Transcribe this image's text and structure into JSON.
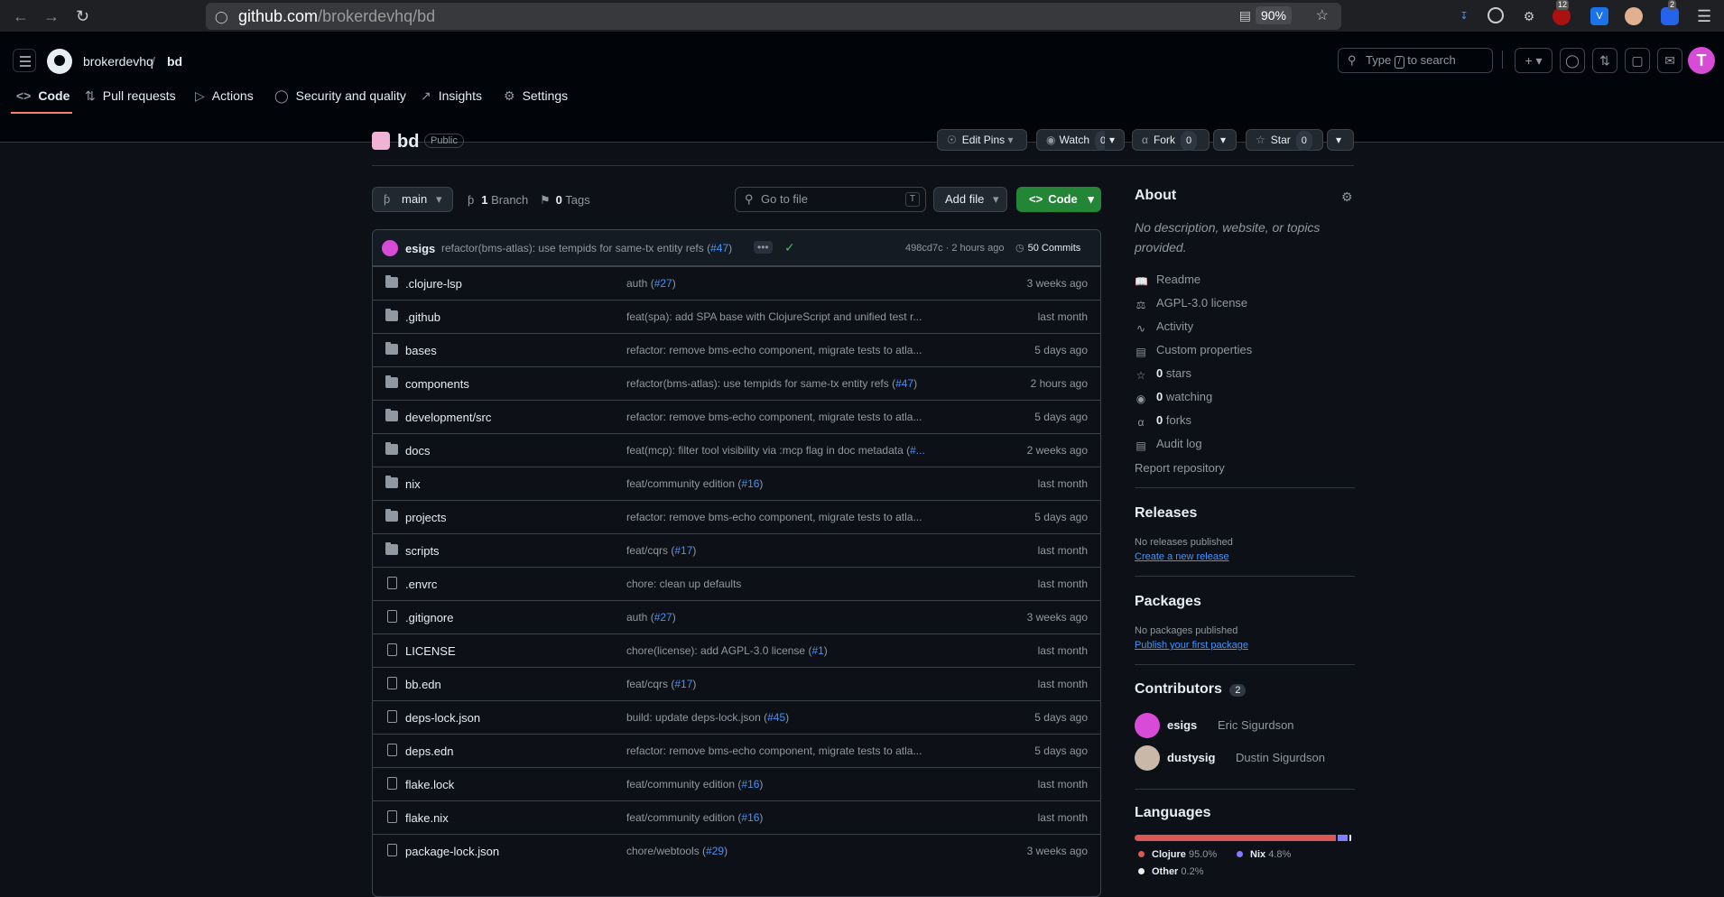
{
  "browser": {
    "url_host": "github.com",
    "url_path": "/brokerdevhq/bd",
    "zoom": "90%",
    "ext_badge_1": "12",
    "ext_badge_2": "2"
  },
  "header": {
    "org": "brokerdevhq",
    "sep": "/",
    "repo": "bd",
    "search_placeholder_pre": "Type",
    "search_key": "/",
    "search_placeholder_post": "to search",
    "avatar_letter": "T"
  },
  "tabs": [
    {
      "label": "Code",
      "icon": "code-icon"
    },
    {
      "label": "Pull requests",
      "icon": "pull-request-icon"
    },
    {
      "label": "Actions",
      "icon": "play-icon"
    },
    {
      "label": "Security and quality",
      "icon": "shield-icon"
    },
    {
      "label": "Insights",
      "icon": "graph-icon"
    },
    {
      "label": "Settings",
      "icon": "gear-icon"
    }
  ],
  "repo": {
    "name": "bd",
    "visibility": "Public",
    "edit_pins": "Edit Pins",
    "watch": "Watch",
    "watch_count": "0",
    "fork": "Fork",
    "fork_count": "0",
    "star": "Star",
    "star_count": "0"
  },
  "toolbar": {
    "branch": "main",
    "branches_count": "1",
    "branches_label": "Branch",
    "tags_count": "0",
    "tags_label": "Tags",
    "goto_placeholder": "Go to file",
    "goto_key": "T",
    "add_file": "Add file",
    "code": "Code"
  },
  "commit": {
    "user": "esigs",
    "message": "refactor(bms-atlas): use tempids for same-tx entity refs (",
    "pr": "#47",
    "message_end": ")",
    "dots": "•••",
    "hash_time": "498cd7c · 2 hours ago",
    "commits": "50 Commits"
  },
  "files": [
    {
      "name": ".clojure-lsp",
      "type": "folder",
      "msg": "auth (",
      "pr": "#27",
      "msg_end": ")",
      "date": "3 weeks ago"
    },
    {
      "name": ".github",
      "type": "folder",
      "msg": "feat(spa): add SPA base with ClojureScript and unified test r...",
      "pr": "",
      "msg_end": "",
      "date": "last month"
    },
    {
      "name": "bases",
      "type": "folder",
      "msg": "refactor: remove bms-echo component, migrate tests to atla...",
      "pr": "",
      "msg_end": "",
      "date": "5 days ago"
    },
    {
      "name": "components",
      "type": "folder",
      "msg": "refactor(bms-atlas): use tempids for same-tx entity refs (",
      "pr": "#47",
      "msg_end": ")",
      "date": "2 hours ago"
    },
    {
      "name": "development/src",
      "type": "folder",
      "msg": "refactor: remove bms-echo component, migrate tests to atla...",
      "pr": "",
      "msg_end": "",
      "date": "5 days ago"
    },
    {
      "name": "docs",
      "type": "folder",
      "msg": "feat(mcp): filter tool visibility via :mcp flag in doc metadata (",
      "pr": "#...",
      "msg_end": "",
      "date": "2 weeks ago"
    },
    {
      "name": "nix",
      "type": "folder",
      "msg": "feat/community edition (",
      "pr": "#16",
      "msg_end": ")",
      "date": "last month"
    },
    {
      "name": "projects",
      "type": "folder",
      "msg": "refactor: remove bms-echo component, migrate tests to atla...",
      "pr": "",
      "msg_end": "",
      "date": "5 days ago"
    },
    {
      "name": "scripts",
      "type": "folder",
      "msg": "feat/cqrs (",
      "pr": "#17",
      "msg_end": ")",
      "date": "last month"
    },
    {
      "name": ".envrc",
      "type": "file",
      "msg": "chore: clean up defaults",
      "pr": "",
      "msg_end": "",
      "date": "last month"
    },
    {
      "name": ".gitignore",
      "type": "file",
      "msg": "auth (",
      "pr": "#27",
      "msg_end": ")",
      "date": "3 weeks ago"
    },
    {
      "name": "LICENSE",
      "type": "file",
      "msg": "chore(license): add AGPL-3.0 license (",
      "pr": "#1",
      "msg_end": ")",
      "date": "last month"
    },
    {
      "name": "bb.edn",
      "type": "file",
      "msg": "feat/cqrs (",
      "pr": "#17",
      "msg_end": ")",
      "date": "last month"
    },
    {
      "name": "deps-lock.json",
      "type": "file",
      "msg": "build: update deps-lock.json (",
      "pr": "#45",
      "msg_end": ")",
      "date": "5 days ago"
    },
    {
      "name": "deps.edn",
      "type": "file",
      "msg": "refactor: remove bms-echo component, migrate tests to atla...",
      "pr": "",
      "msg_end": "",
      "date": "5 days ago"
    },
    {
      "name": "flake.lock",
      "type": "file",
      "msg": "feat/community edition (",
      "pr": "#16",
      "msg_end": ")",
      "date": "last month"
    },
    {
      "name": "flake.nix",
      "type": "file",
      "msg": "feat/community edition (",
      "pr": "#16",
      "msg_end": ")",
      "date": "last month"
    },
    {
      "name": "package-lock.json",
      "type": "file",
      "msg": "chore/webtools (",
      "pr": "#29",
      "msg_end": ")",
      "date": "3 weeks ago"
    }
  ],
  "about": {
    "title": "About",
    "description": "No description, website, or topics provided.",
    "readme": "Readme",
    "license": "AGPL-3.0 license",
    "activity": "Activity",
    "custom_properties": "Custom properties",
    "stars_count": "0",
    "stars_label": "stars",
    "watching_count": "0",
    "watching_label": "watching",
    "forks_count": "0",
    "forks_label": "forks",
    "audit_log": "Audit log",
    "report": "Report repository"
  },
  "releases": {
    "title": "Releases",
    "empty": "No releases published",
    "create": "Create a new release"
  },
  "packages": {
    "title": "Packages",
    "empty": "No packages published",
    "publish": "Publish your first package"
  },
  "contributors": {
    "title": "Contributors",
    "count": "2",
    "list": [
      {
        "user": "esigs",
        "name": "Eric Sigurdson"
      },
      {
        "user": "dustysig",
        "name": "Dustin Sigurdson"
      }
    ]
  },
  "languages": {
    "title": "Languages",
    "list": [
      {
        "name": "Clojure",
        "pct": "95.0%",
        "value": 95.0,
        "color": "#db5855"
      },
      {
        "name": "Nix",
        "pct": "4.8%",
        "value": 4.8,
        "color": "#7e7eff"
      },
      {
        "name": "Other",
        "pct": "0.2%",
        "value": 0.2,
        "color": "#ededed"
      }
    ]
  }
}
